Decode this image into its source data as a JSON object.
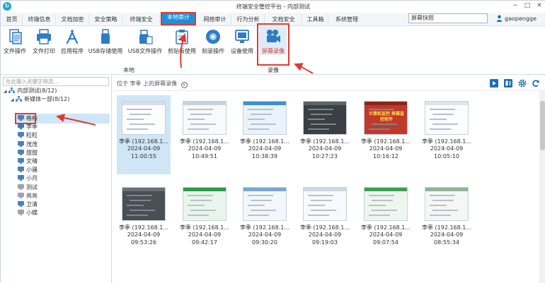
{
  "window": {
    "title": "终端安全管控平台 - 内部测试"
  },
  "menu": {
    "items": [
      "首页",
      "终端信息",
      "文档加密",
      "安全策略",
      "终端安全",
      "本地审计",
      "网络审计",
      "行为分析",
      "文档安全",
      "工具箱",
      "系统管理"
    ],
    "active_index": 5
  },
  "search": {
    "value": "屏幕快照"
  },
  "user": {
    "name": "gaopengge"
  },
  "ribbon": {
    "buttons": [
      "文件操作",
      "文件打印",
      "应用程序",
      "USB存储使用",
      "USB文件操作",
      "剪贴板使用",
      "刻录操作",
      "设备使用",
      "屏幕录像"
    ],
    "group_local": "本地",
    "group_record": "录像",
    "active_button": "屏幕录像"
  },
  "left": {
    "search_placeholder": "在此输入关键字筛选...",
    "root": "内部测试(8/12)",
    "group": "新媒体一部(8/12)",
    "members": [
      "格格",
      "李季",
      "粒粒",
      "茂茂",
      "甜甜",
      "文晴",
      "小骚",
      "小月",
      "测试",
      "亮亮",
      "卫清",
      "小蝶"
    ],
    "selected": "李季"
  },
  "main": {
    "path": "位于 李季 上的屏幕录像",
    "thumb_name": "李季 (192.168.1...",
    "row1": [
      {
        "date": "2024-04-09",
        "time": "11:00:55"
      },
      {
        "date": "2024-04-09",
        "time": "10:49:51"
      },
      {
        "date": "2024-04-09",
        "time": "10:38:39"
      },
      {
        "date": "2024-04-09",
        "time": "10:27:23"
      },
      {
        "date": "2024-04-09",
        "time": "10:16:12"
      },
      {
        "date": "2024-04-09",
        "time": "10:05:10"
      }
    ],
    "row2": [
      {
        "date": "2024-04-09",
        "time": "09:53:26"
      },
      {
        "date": "2024-04-09",
        "time": "09:42:17"
      },
      {
        "date": "2024-04-09",
        "time": "09:30:20"
      },
      {
        "date": "2024-04-09",
        "time": "09:19:03"
      },
      {
        "date": "2024-04-09",
        "time": "09:07:54"
      },
      {
        "date": "2024-04-09",
        "time": "08:55:34"
      }
    ],
    "promo_text": "计算机监控 屏幕监控软件"
  },
  "colors": {
    "accent": "#1f8fd8",
    "highlight": "#e03b2f",
    "selection": "#cfe6f7"
  }
}
